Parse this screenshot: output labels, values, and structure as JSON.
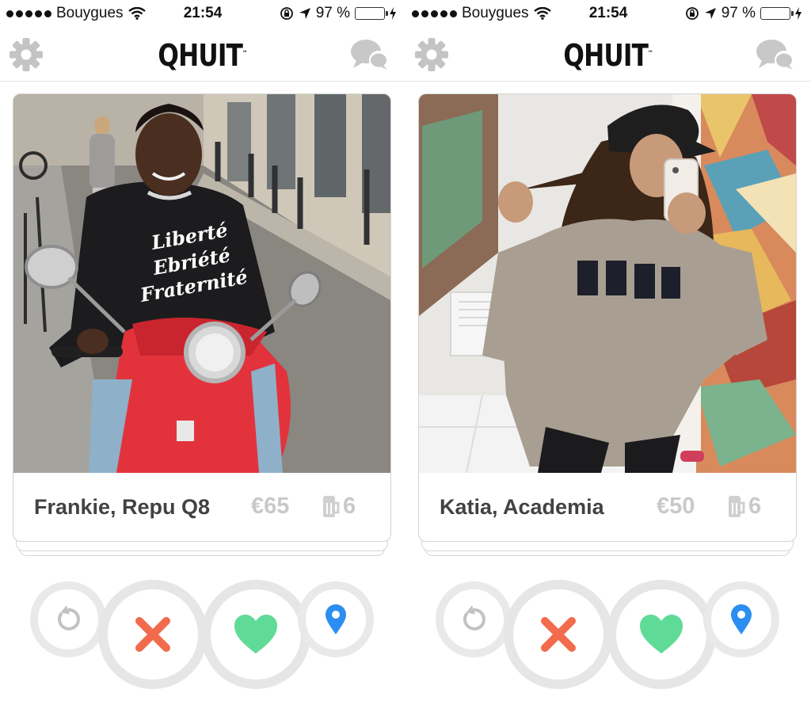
{
  "status_bar": {
    "carrier": "Bouygues",
    "time": "21:54",
    "battery": "97 %",
    "battery_level": 0.97
  },
  "app": {
    "logo": "QHUIT",
    "logo_tm": "™"
  },
  "screens": [
    {
      "profile": {
        "name_line": "Frankie, Repu Q8",
        "price": "€65",
        "beers": "6"
      }
    },
    {
      "profile": {
        "name_line": "Katia, Academia",
        "price": "€50",
        "beers": "6"
      }
    }
  ],
  "icons": {
    "settings": "gear-icon",
    "messages": "chat-bubbles-icon",
    "undo": "undo-icon",
    "nope": "x-icon",
    "like": "heart-icon",
    "location": "location-pin-icon",
    "beer": "beer-mug-icon"
  },
  "colors": {
    "nope": "#f26b4c",
    "like": "#5fdb97",
    "location": "#2b8ef0",
    "battery": "#4cd964",
    "muted_text": "#c9c9c9",
    "name_text": "#424242"
  }
}
